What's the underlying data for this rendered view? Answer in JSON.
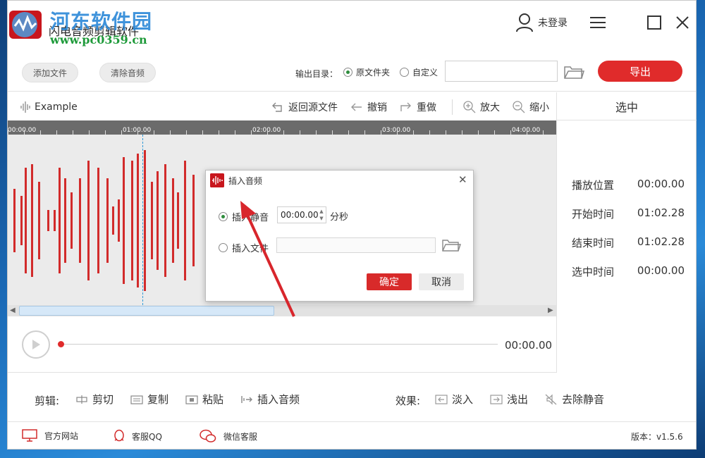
{
  "watermark": {
    "title": "河东软件园",
    "url": "www.pc0359.cn"
  },
  "app": {
    "title": "闪电音频剪辑软件"
  },
  "user": {
    "label": "未登录"
  },
  "window": {
    "menu_icon": "hamburger-icon",
    "max_icon": "maximize-icon",
    "close_icon": "close-icon"
  },
  "toolbar": {
    "add_file": "添加文件",
    "clear_audio": "清除音频",
    "output_dir_label": "输出目录：",
    "opt_source": "原文件夹",
    "opt_custom": "自定义",
    "output_dir_value": "",
    "export": "导出"
  },
  "editor": {
    "file_name": "Example",
    "tools": {
      "revert": "返回源文件",
      "undo": "撤销",
      "redo": "重做",
      "zoom_in": "放大",
      "zoom_out": "缩小"
    },
    "ruler_ticks": [
      "00:00.00",
      "01:00.00",
      "02:00.00",
      "03:00.00",
      "04:00.00"
    ]
  },
  "player": {
    "time": "00:00.00"
  },
  "selection": {
    "title": "选中",
    "rows": [
      {
        "label": "播放位置",
        "value": "00:00.00"
      },
      {
        "label": "开始时间",
        "value": "01:02.28"
      },
      {
        "label": "结束时间",
        "value": "01:02.28"
      },
      {
        "label": "选中时间",
        "value": "00:00.00"
      }
    ]
  },
  "edit_bar": {
    "edit_label": "剪辑:",
    "cut": "剪切",
    "copy": "复制",
    "paste": "粘贴",
    "insert_audio": "插入音频",
    "effects_label": "效果:",
    "fade_in": "淡入",
    "fade_out": "浅出",
    "remove_silence": "去除静音"
  },
  "footer": {
    "website": "官方网站",
    "qq": "客服QQ",
    "wechat": "微信客服",
    "version": "版本：v1.5.6"
  },
  "dialog": {
    "title": "插入音频",
    "opt_silence": "插入静音",
    "silence_value": "00:00.00",
    "unit": "分秒",
    "opt_file": "插入文件",
    "file_value": "",
    "ok": "确定",
    "cancel": "取消"
  },
  "colors": {
    "accent": "#e02b2b",
    "waveform": "#d22b2b",
    "radio_on": "#2d8c3c",
    "cursor": "#2f9ad8"
  }
}
